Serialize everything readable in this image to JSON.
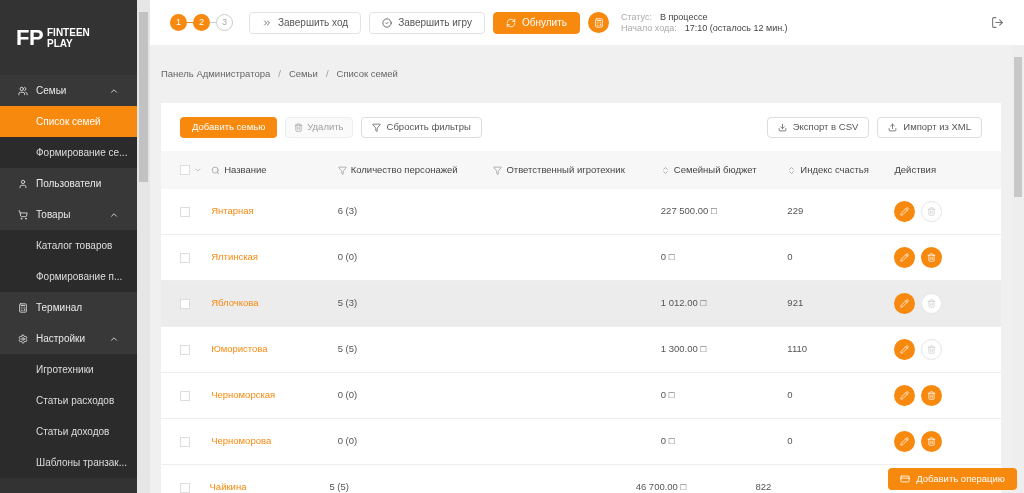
{
  "logo": {
    "mark": "FP",
    "name_line1": "FINTEEN",
    "name_line2": "PLAY"
  },
  "sidebar": {
    "items": [
      {
        "label": "Семьи",
        "expanded": true,
        "children": [
          {
            "label": "Список семей",
            "selected": true
          },
          {
            "label": "Формирование се...",
            "selected": false
          }
        ]
      },
      {
        "label": "Пользователи"
      },
      {
        "label": "Товары",
        "expanded": true,
        "children": [
          {
            "label": "Каталог товаров",
            "selected": false
          },
          {
            "label": "Формирование п...",
            "selected": false
          }
        ]
      },
      {
        "label": "Терминал"
      },
      {
        "label": "Настройки",
        "expanded": true,
        "children": [
          {
            "label": "Игротехники",
            "selected": false
          },
          {
            "label": "Статьи расходов",
            "selected": false
          },
          {
            "label": "Статьи доходов",
            "selected": false
          },
          {
            "label": "Шаблоны транзак...",
            "selected": false
          }
        ]
      }
    ]
  },
  "header": {
    "steps": [
      {
        "label": "1",
        "done": true
      },
      {
        "label": "2",
        "done": true
      },
      {
        "label": "3",
        "done": false
      }
    ],
    "buttons": [
      {
        "label": "Завершить ход",
        "kind": "next"
      },
      {
        "label": "Завершить игру",
        "kind": "finish"
      },
      {
        "label": "Обнулить",
        "kind": "reset"
      }
    ],
    "status_label": "Статус:",
    "status_value": "В процессе",
    "start_label": "Начало хода:",
    "start_value": "17:10 (осталось 12 мин.)"
  },
  "breadcrumbs": {
    "separator": "/",
    "items": [
      "Панель Администратора",
      "Семьи",
      "Список семей"
    ]
  },
  "toolbar": {
    "add": "Добавить семью",
    "delete": {
      "label": "Удалить",
      "disabled": true
    },
    "reset_filters": "Сбросить фильтры",
    "export": "Экспорт в CSV",
    "import": "Импорт из XML"
  },
  "table": {
    "select_all_checked": false,
    "columns": [
      {
        "label": "Название",
        "kind": "search"
      },
      {
        "label": "Количество персонажей",
        "kind": "filter"
      },
      {
        "label": "Ответственный игротехник",
        "kind": "filter"
      },
      {
        "label": "Семейный бюджет",
        "kind": "sort"
      },
      {
        "label": "Индекс счастья",
        "kind": "sort"
      },
      {
        "label": "Действия",
        "kind": "plain"
      }
    ],
    "rows": [
      {
        "name": "Янтарная",
        "count": "6 (3)",
        "budget": "227 500.00 □",
        "index": "229",
        "deletable": false,
        "hovered": false
      },
      {
        "name": "Ялтинская",
        "count": "0 (0)",
        "budget": "0 □",
        "index": "0",
        "deletable": true,
        "hovered": false
      },
      {
        "name": "Яблочкова",
        "count": "5 (3)",
        "budget": "1 012.00 □",
        "index": "921",
        "deletable": false,
        "hovered": true
      },
      {
        "name": "Юмористова",
        "count": "5 (5)",
        "budget": "1 300.00 □",
        "index": "1110",
        "deletable": false,
        "hovered": false
      },
      {
        "name": "Черноморская",
        "count": "0 (0)",
        "budget": "0 □",
        "index": "0",
        "deletable": true,
        "hovered": false
      },
      {
        "name": "Черноморова",
        "count": "0 (0)",
        "budget": "0 □",
        "index": "0",
        "deletable": true,
        "hovered": false
      },
      {
        "name": "Чайкина",
        "count": "5 (5)",
        "budget": "46 700.00 □",
        "index": "822",
        "hovered": false
      }
    ]
  },
  "add_operation": "Добавить операцию"
}
